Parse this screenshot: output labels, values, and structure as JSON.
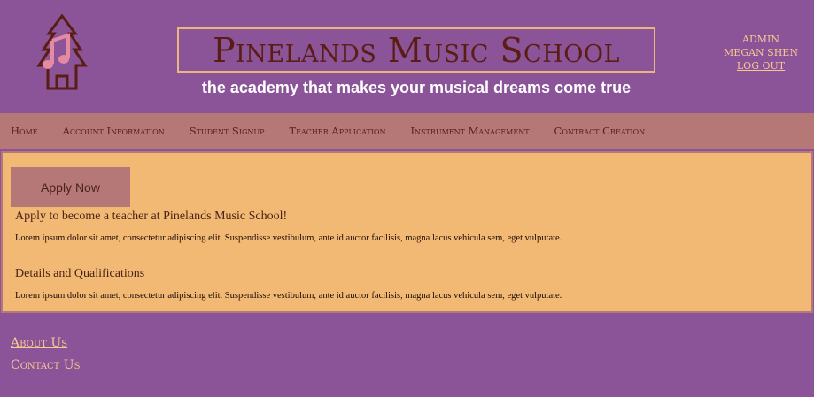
{
  "header": {
    "title": "Pinelands Music School",
    "tagline": "the academy that makes your musical dreams come true",
    "logo_icon": "pine-tree-music-note-logo"
  },
  "user": {
    "role": "ADMIN",
    "name": "MEGAN SHEN",
    "logout_label": "LOG OUT"
  },
  "nav": {
    "items": [
      {
        "label": "Home"
      },
      {
        "label": "Account Information"
      },
      {
        "label": "Student Signup"
      },
      {
        "label": "Teacher Application"
      },
      {
        "label": "Instrument Management"
      },
      {
        "label": "Contract Creation"
      }
    ]
  },
  "main": {
    "apply_button_label": "Apply Now",
    "sections": [
      {
        "heading": "Apply to become a teacher at Pinelands Music School!",
        "body": "Lorem ipsum dolor sit amet, consectetur adipiscing elit. Suspendisse vestibulum, ante id auctor facilisis, magna lacus vehicula sem, eget vulputate."
      },
      {
        "heading": "Details and Qualifications",
        "body": "Lorem ipsum dolor sit amet, consectetur adipiscing elit. Suspendisse vestibulum, ante id auctor facilisis, magna lacus vehicula sem, eget vulputate."
      }
    ]
  },
  "footer": {
    "about_label": "About Us",
    "contact_label": "Contact Us"
  },
  "colors": {
    "background": "#8b5499",
    "nav_background": "#b67877",
    "panel_background": "#f2b974",
    "title_text": "#5a1d14",
    "accent_text": "#f7c98e"
  }
}
